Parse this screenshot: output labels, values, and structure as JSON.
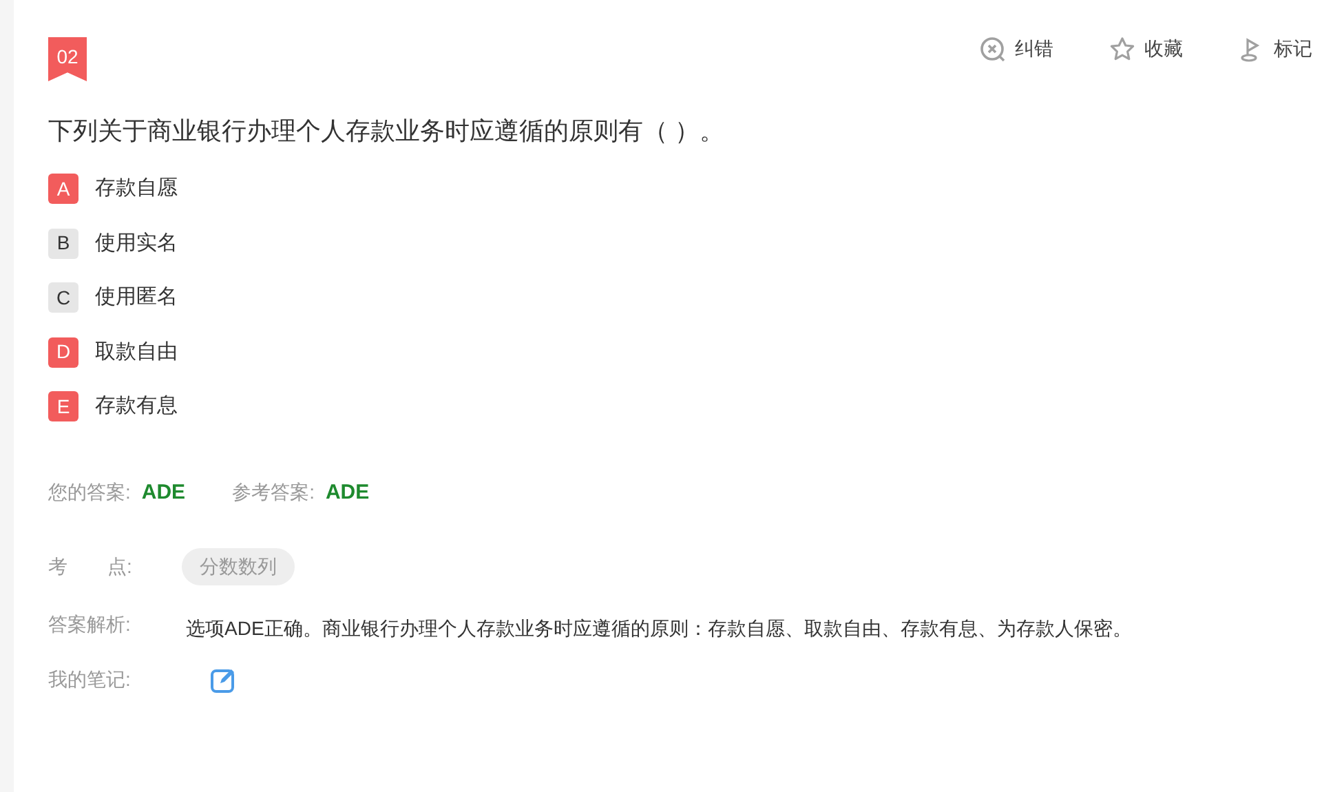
{
  "question": {
    "number": "02",
    "text": "下列关于商业银行办理个人存款业务时应遵循的原则有（ ）。"
  },
  "actions": [
    {
      "kind": "report",
      "label": "纠错"
    },
    {
      "kind": "favorite",
      "label": "收藏"
    },
    {
      "kind": "mark",
      "label": "标记"
    }
  ],
  "options": [
    {
      "letter": "A",
      "text": "存款自愿",
      "selected": true
    },
    {
      "letter": "B",
      "text": "使用实名",
      "selected": false
    },
    {
      "letter": "C",
      "text": "使用匿名",
      "selected": false
    },
    {
      "letter": "D",
      "text": "取款自由",
      "selected": true
    },
    {
      "letter": "E",
      "text": "存款有息",
      "selected": true
    }
  ],
  "your_answer": {
    "label": "您的答案:",
    "value": "ADE"
  },
  "reference_answer": {
    "label": "参考答案:",
    "value": "ADE"
  },
  "knowledge_point": {
    "label_first": "考",
    "label_second": "点:",
    "tag": "分数数列"
  },
  "analysis": {
    "label": "答案解析:",
    "text": "选项ADE正确。商业银行办理个人存款业务时应遵循的原则：存款自愿、取款自由、存款有息、为存款人保密。"
  },
  "notes": {
    "label": "我的笔记:"
  }
}
